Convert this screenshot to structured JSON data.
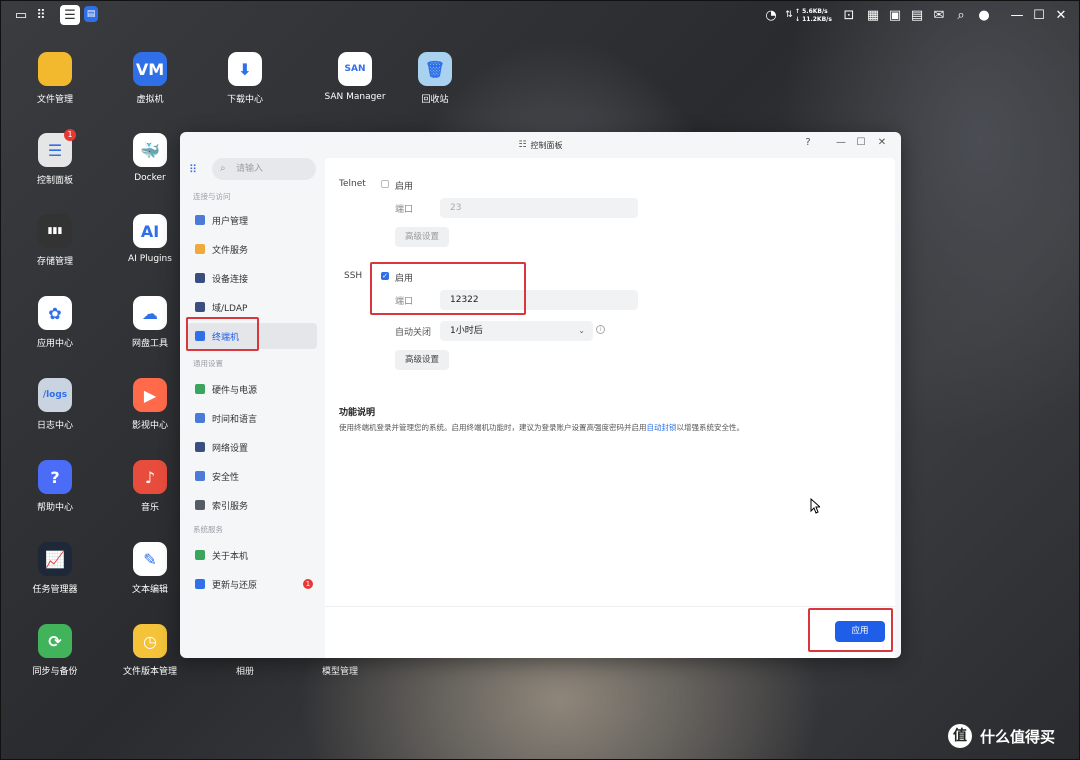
{
  "topbar": {
    "speed_up": "↑ 5.6KB/s",
    "speed_down": "↓ 11.2KB/s"
  },
  "desktop": {
    "icons": [
      {
        "label": "文件管理",
        "color": "#f2b92e"
      },
      {
        "label": "虚拟机",
        "color": "#2f6fe7",
        "glyph": "VM"
      },
      {
        "label": "下载中心",
        "color": "#ffffff",
        "glyph": "⬇"
      },
      {
        "label": "SAN Manager",
        "color": "#ffffff",
        "glyph": "SAN"
      },
      {
        "label": "回收站",
        "color": "#a9d2f0",
        "glyph": "🗑"
      },
      {
        "label": "控制面板",
        "color": "#e6e6e6",
        "glyph": "☰",
        "badge": "1"
      },
      {
        "label": "Docker",
        "color": "#ffffff",
        "glyph": "🐳"
      },
      {
        "label": "存储管理",
        "color": "#333333",
        "glyph": "▮▮▮"
      },
      {
        "label": "AI Plugins",
        "color": "#ffffff",
        "glyph": "AI"
      },
      {
        "label": "应用中心",
        "color": "#ffffff",
        "glyph": "✿"
      },
      {
        "label": "网盘工具",
        "color": "#ffffff",
        "glyph": "☁"
      },
      {
        "label": "日志中心",
        "color": "#c9d4e0",
        "glyph": "/logs"
      },
      {
        "label": "影视中心",
        "color": "#ff6a4b",
        "glyph": "▶"
      },
      {
        "label": "帮助中心",
        "color": "#4a6cf7",
        "glyph": "?"
      },
      {
        "label": "音乐",
        "color": "#e84c3d",
        "glyph": "♪"
      },
      {
        "label": "任务管理器",
        "color": "#1e2838",
        "glyph": "📈"
      },
      {
        "label": "文本编辑",
        "color": "#ffffff",
        "glyph": "✎"
      },
      {
        "label": "同步与备份",
        "color": "#41b35a",
        "glyph": "⟳"
      },
      {
        "label": "文件版本管理",
        "color": "#f4c33a",
        "glyph": "◷"
      },
      {
        "label": "相册"
      },
      {
        "label": "模型管理"
      }
    ]
  },
  "window": {
    "title": "控制面板",
    "help": "?",
    "min": "—",
    "max": "☐",
    "close": "✕"
  },
  "sidebar": {
    "search_placeholder": "请输入",
    "groups": [
      "连接与访问",
      "通用设置",
      "系统服务"
    ],
    "items": [
      {
        "label": "用户管理",
        "color": "#4a7bd8"
      },
      {
        "label": "文件服务",
        "color": "#f2a93b"
      },
      {
        "label": "设备连接",
        "color": "#3a4f80"
      },
      {
        "label": "域/LDAP",
        "color": "#3a4f80"
      },
      {
        "label": "终端机",
        "color": "#2f6fe7"
      },
      {
        "label": "硬件与电源",
        "color": "#3aa55c"
      },
      {
        "label": "时间和语言",
        "color": "#4a7bd8"
      },
      {
        "label": "网络设置",
        "color": "#3a4f80"
      },
      {
        "label": "安全性",
        "color": "#4a7bd8"
      },
      {
        "label": "索引服务",
        "color": "#555c66"
      },
      {
        "label": "关于本机",
        "color": "#3aa55c"
      },
      {
        "label": "更新与还原",
        "color": "#2f6fe7",
        "badge": "1"
      }
    ]
  },
  "content": {
    "telnet": {
      "section": "Telnet",
      "enable": "启用",
      "port_label": "端口",
      "port_value": "23",
      "advanced": "高级设置"
    },
    "ssh": {
      "section": "SSH",
      "enable": "启用",
      "port_label": "端口",
      "port_value": "12322",
      "auto_close_label": "自动关闭",
      "auto_close_value": "1小时后",
      "advanced": "高级设置"
    },
    "desc": {
      "title": "功能说明",
      "text_before": "使用终端机登录并管理您的系统。启用终端机功能时，建议为登录账户设置高强度密码并启用",
      "link": "自动封锁",
      "text_after": "以增强系统安全性。"
    },
    "apply": "应用"
  },
  "watermark": {
    "logo": "值",
    "text": "什么值得买"
  }
}
